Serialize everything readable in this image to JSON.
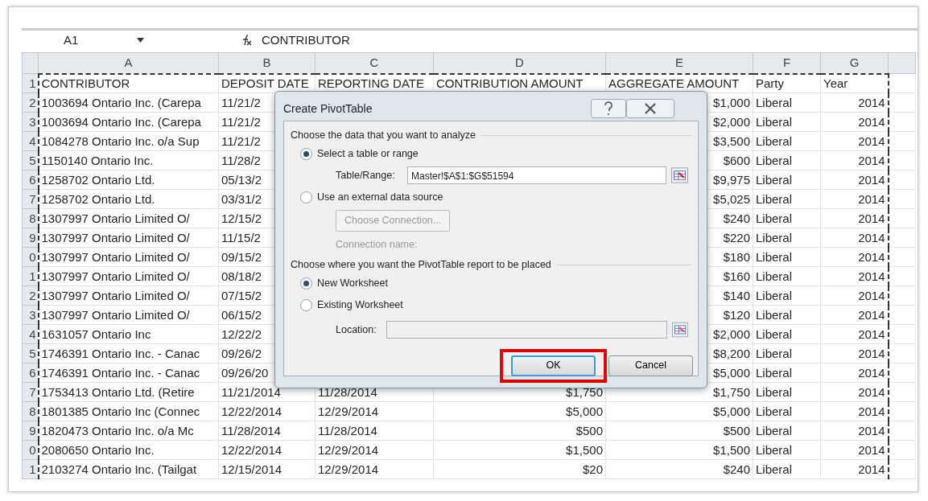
{
  "formula_bar": {
    "name_box": "A1",
    "formula": "CONTRIBUTOR"
  },
  "columns": [
    "A",
    "B",
    "C",
    "D",
    "E",
    "F",
    "G"
  ],
  "rows": [
    {
      "number": "1",
      "a": "CONTRIBUTOR",
      "b": "DEPOSIT DATE",
      "c": "REPORTING DATE",
      "d": "CONTRIBUTION AMOUNT",
      "e": "AGGREGATE AMOUNT",
      "f": "Party",
      "g": "Year"
    },
    {
      "number": "2",
      "a": "1003694 Ontario Inc. (Carepa",
      "b": "11/21/2",
      "e": "$1,000",
      "f": "Liberal",
      "g": "2014"
    },
    {
      "number": "3",
      "a": "1003694 Ontario Inc. (Carepa",
      "b": "11/21/2",
      "e": "$2,000",
      "f": "Liberal",
      "g": "2014"
    },
    {
      "number": "4",
      "a": "1084278 Ontario Inc. o/a Sup",
      "b": "11/21/2",
      "e": "$3,500",
      "f": "Liberal",
      "g": "2014"
    },
    {
      "number": "5",
      "a": "1150140 Ontario Inc.",
      "b": "11/28/2",
      "e": "$600",
      "f": "Liberal",
      "g": "2014"
    },
    {
      "number": "6",
      "a": "1258702 Ontario Ltd.",
      "b": "05/13/2",
      "e": "$9,975",
      "f": "Liberal",
      "g": "2014"
    },
    {
      "number": "7",
      "a": "1258702 Ontario Ltd.",
      "b": "03/31/2",
      "e": "$5,025",
      "f": "Liberal",
      "g": "2014"
    },
    {
      "number": "8",
      "a": "1307997 Ontario Limited O/",
      "b": "12/15/2",
      "e": "$240",
      "f": "Liberal",
      "g": "2014"
    },
    {
      "number": "9",
      "a": "1307997 Ontario Limited O/",
      "b": "11/15/2",
      "e": "$220",
      "f": "Liberal",
      "g": "2014"
    },
    {
      "number": "0",
      "a": "1307997 Ontario Limited O/",
      "b": "09/15/2",
      "e": "$180",
      "f": "Liberal",
      "g": "2014"
    },
    {
      "number": "1",
      "a": "1307997 Ontario Limited O/",
      "b": "08/18/2",
      "e": "$160",
      "f": "Liberal",
      "g": "2014"
    },
    {
      "number": "2",
      "a": "1307997 Ontario Limited O/",
      "b": "07/15/2",
      "e": "$140",
      "f": "Liberal",
      "g": "2014"
    },
    {
      "number": "3",
      "a": "1307997 Ontario Limited O/",
      "b": "06/15/2",
      "e": "$120",
      "f": "Liberal",
      "g": "2014"
    },
    {
      "number": "4",
      "a": "1631057 Ontario Inc",
      "b": "12/22/2",
      "e": "$2,000",
      "f": "Liberal",
      "g": "2014"
    },
    {
      "number": "5",
      "a": "1746391 Ontario Inc. - Canac",
      "b": "09/26/2",
      "e": "$8,200",
      "f": "Liberal",
      "g": "2014"
    },
    {
      "number": "6",
      "a": "1746391 Ontario Inc. - Canac",
      "b": "09/26/20",
      "e": "$5,000",
      "f": "Liberal",
      "g": "2014"
    },
    {
      "number": "7",
      "a": "1753413 Ontario Ltd. (Retire",
      "b": "11/21/2014",
      "c": "11/28/2014",
      "d": "$1,750",
      "e": "$1,750",
      "f": "Liberal",
      "g": "2014"
    },
    {
      "number": "8",
      "a": "1801385 Ontario Inc (Connec",
      "b": "12/22/2014",
      "c": "12/29/2014",
      "d": "$5,000",
      "e": "$5,000",
      "f": "Liberal",
      "g": "2014"
    },
    {
      "number": "9",
      "a": "1820473 Ontario Inc. o/a Mc",
      "b": "11/28/2014",
      "c": "11/28/2014",
      "d": "$500",
      "e": "$500",
      "f": "Liberal",
      "g": "2014"
    },
    {
      "number": "0",
      "a": "2080650 Ontario Inc.",
      "b": "12/22/2014",
      "c": "12/29/2014",
      "d": "$1,500",
      "e": "$1,500",
      "f": "Liberal",
      "g": "2014"
    },
    {
      "number": "1",
      "a": "2103274 Ontario Inc. (Tailgat",
      "b": "12/15/2014",
      "c": "12/29/2014",
      "d": "$20",
      "e": "$240",
      "f": "Liberal",
      "g": "2014"
    }
  ],
  "dialog": {
    "title": "Create PivotTable",
    "sections": [
      {
        "heading": "Choose the data that you want to analyze",
        "options": [
          {
            "kind": "radio",
            "label": "Select a table or range",
            "selected": true
          },
          {
            "kind": "field",
            "label": "Table/Range:",
            "value": "Master!$A$1:$G$51594",
            "disabled": false
          },
          {
            "kind": "radio",
            "label": "Use an external data source",
            "selected": false
          },
          {
            "kind": "button",
            "label": "Choose Connection...",
            "disabled": true
          },
          {
            "kind": "note",
            "label": "Connection name:",
            "disabled": true
          }
        ]
      },
      {
        "heading": "Choose where you want the PivotTable report to be placed",
        "options": [
          {
            "kind": "radio",
            "label": "New Worksheet",
            "selected": true
          },
          {
            "kind": "radio",
            "label": "Existing Worksheet",
            "selected": false
          },
          {
            "kind": "field",
            "label": "Location:",
            "disabled": true
          }
        ]
      }
    ],
    "buttons": [
      {
        "label": "OK",
        "default": true,
        "highlighted": true
      },
      {
        "label": "Cancel",
        "default": false,
        "highlighted": false
      }
    ]
  }
}
